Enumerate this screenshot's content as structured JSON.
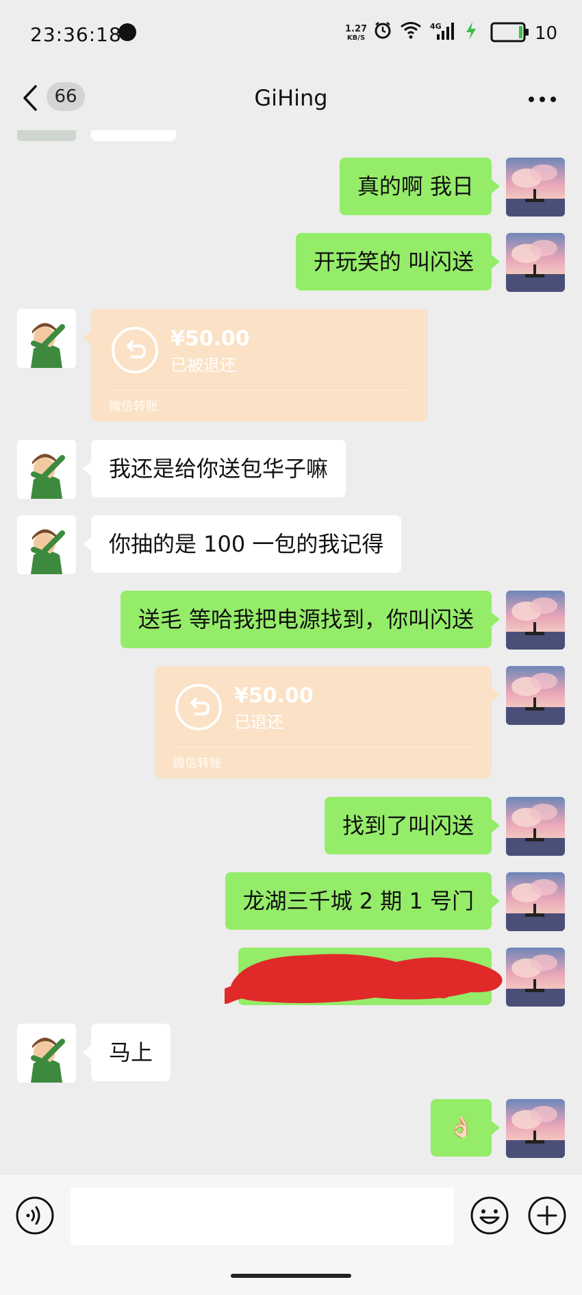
{
  "status_bar": {
    "time": "23:36:18",
    "net_speed_value": "1.27",
    "net_speed_unit": "KB/S",
    "network_type": "4G",
    "battery_level": "10"
  },
  "nav": {
    "back_badge": "66",
    "title": "GiHing",
    "more_icon": "more-dots-icon",
    "back_icon": "chevron-left-icon"
  },
  "messages": [
    {
      "side": "out",
      "type": "text",
      "text": "真的啊 我日"
    },
    {
      "side": "out",
      "type": "text",
      "text": "开玩笑的 叫闪送"
    },
    {
      "side": "in",
      "type": "transfer",
      "amount": "¥50.00",
      "status": "已被退还",
      "footer": "微信转账"
    },
    {
      "side": "in",
      "type": "text",
      "text": "我还是给你送包华子嘛"
    },
    {
      "side": "in",
      "type": "text",
      "text": "你抽的是 100 一包的我记得"
    },
    {
      "side": "out",
      "type": "text",
      "text": "送毛 等哈我把电源找到，你叫闪送"
    },
    {
      "side": "out",
      "type": "transfer",
      "amount": "¥50.00",
      "status": "已退还",
      "footer": "微信转账"
    },
    {
      "side": "out",
      "type": "text",
      "text": "找到了叫闪送"
    },
    {
      "side": "out",
      "type": "text",
      "text": "龙湖三千城 2 期 1 号门"
    },
    {
      "side": "out",
      "type": "redacted",
      "text": ""
    },
    {
      "side": "in",
      "type": "text",
      "text": "马上"
    },
    {
      "side": "out",
      "type": "emoji",
      "text": "👌🏻"
    }
  ],
  "input_bar": {
    "voice_icon": "voice-icon",
    "emoji_icon": "emoji-icon",
    "plus_icon": "plus-icon",
    "placeholder": ""
  },
  "colors": {
    "background": "#ededed",
    "outgoing_bubble": "#95ec69",
    "incoming_bubble": "#ffffff",
    "transfer_card": "#fbe1c5",
    "redaction": "#e02a2a"
  }
}
